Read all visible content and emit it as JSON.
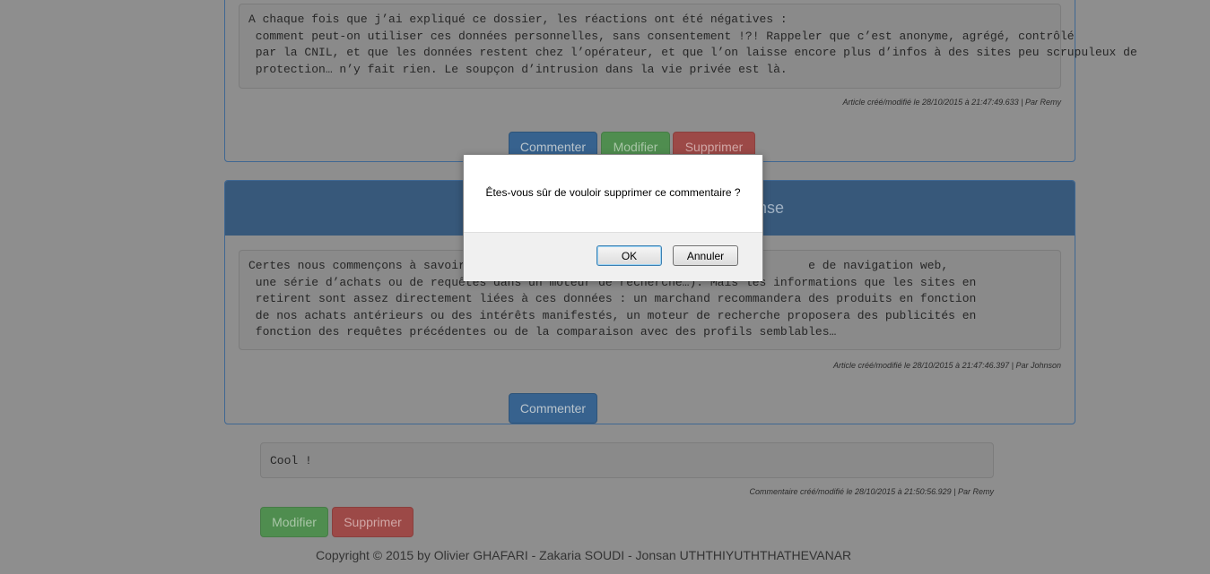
{
  "article1": {
    "body": "A chaque fois que j’ai expliqué ce dossier, les réactions ont été négatives :\n comment peut-on utiliser ces données personnelles, sans consentement !?! Rappeler que c’est anonyme, agrégé, contrôlé\n par la CNIL, et que les données restent chez l’opérateur, et que l’on laisse encore plus d’infos à des sites peu scrupuleux de\n protection… n’y fait rien. Le soupçon d’intrusion dans la vie privée est là.",
    "meta": "Article créé/modifié le 28/10/2015 à 21:47:49.633 | Par Remy",
    "buttons": {
      "comment": "Commenter",
      "edit": "Modifier",
      "delete": "Supprimer"
    }
  },
  "article2": {
    "title_fragment": "pense",
    "body": "Certes nous commençons à savoir qu                                              e de navigation web,\n une série d’achats ou de requêtes dans un moteur de recherche…). Mais les informations que les sites en\n retirent sont assez directement liées à ces données : un marchand recommandera des produits en fonction\n de nos achats antérieurs ou des intérêts manifestés, un moteur de recherche proposera des publicités en\n fonction des requêtes précédentes ou de la comparaison avec des profils semblables…",
    "meta": "Article créé/modifié le 28/10/2015 à 21:47:46.397 | Par Johnson",
    "buttons": {
      "comment": "Commenter"
    }
  },
  "comment": {
    "body": "Cool !",
    "meta": "Commentaire créé/modifié le 28/10/2015 à 21:50:56.929 | Par Remy",
    "buttons": {
      "edit": "Modifier",
      "delete": "Supprimer"
    }
  },
  "footer": {
    "copyright": "Copyright © 2015 by Olivier GHAFARI - Zakaria SOUDI - Jonsan UTHTHIYUTHTHATHEVANAR"
  },
  "dialog": {
    "message": "Êtes-vous sûr de vouloir supprimer ce commentaire ?",
    "ok": "OK",
    "cancel": "Annuler"
  }
}
